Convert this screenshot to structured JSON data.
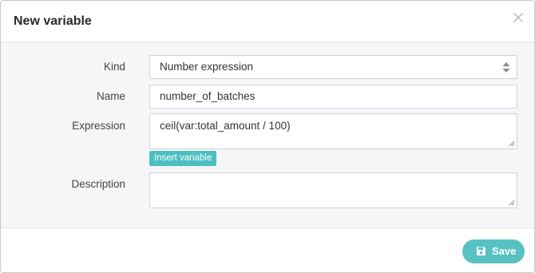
{
  "dialog": {
    "title": "New variable"
  },
  "form": {
    "kind": {
      "label": "Kind",
      "value": "Number expression"
    },
    "name": {
      "label": "Name",
      "value": "number_of_batches"
    },
    "expression": {
      "label": "Expression",
      "value": "ceil(var:total_amount / 100)"
    },
    "insert_variable_label": "Insert variable",
    "description": {
      "label": "Description",
      "value": ""
    }
  },
  "footer": {
    "save_label": "Save"
  },
  "colors": {
    "accent": "#58c2c2",
    "insert_button": "#4cbfc1",
    "body_background": "#f5f6f8"
  },
  "icons": {
    "close": "close-icon",
    "select_arrows": "sort-arrows-icon",
    "save": "floppy-disk-icon",
    "resize": "resize-grip-icon"
  }
}
